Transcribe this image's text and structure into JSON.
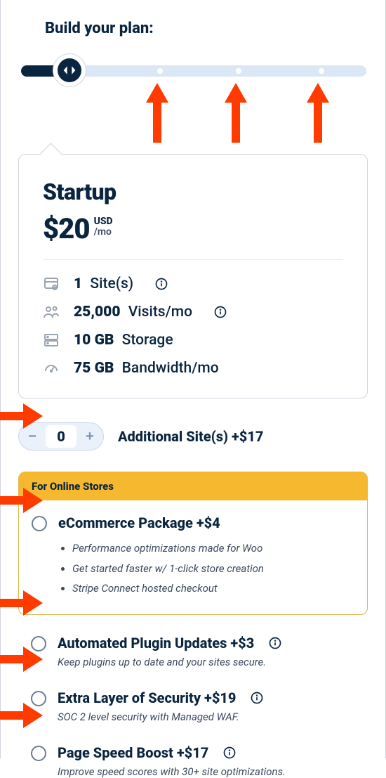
{
  "title": "Build your plan:",
  "plan": {
    "name": "Startup",
    "price": "$20",
    "currency": "USD",
    "period": "/mo",
    "specs": {
      "sites_value": "1",
      "sites_label": "Site(s)",
      "visits_value": "25,000",
      "visits_label": "Visits/mo",
      "storage_value": "10 GB",
      "storage_label": "Storage",
      "bandwidth_value": "75 GB",
      "bandwidth_label": "Bandwidth/mo"
    }
  },
  "stepper": {
    "value": "0",
    "label": "Additional Site(s) +$17"
  },
  "ecommerce": {
    "badge": "For Online Stores",
    "title": "eCommerce Package +$4",
    "bullets": [
      "Performance optimizations made for Woo",
      "Get started faster w/ 1-click store creation",
      "Stripe Connect hosted checkout"
    ]
  },
  "addons": [
    {
      "title": "Automated Plugin Updates +$3",
      "desc": "Keep plugins up to date and your sites secure."
    },
    {
      "title": "Extra Layer of Security +$19",
      "desc": "SOC 2 level security with Managed WAF."
    },
    {
      "title": "Page Speed Boost +$17",
      "desc": "Improve speed scores with 30+ site optimizations."
    }
  ]
}
